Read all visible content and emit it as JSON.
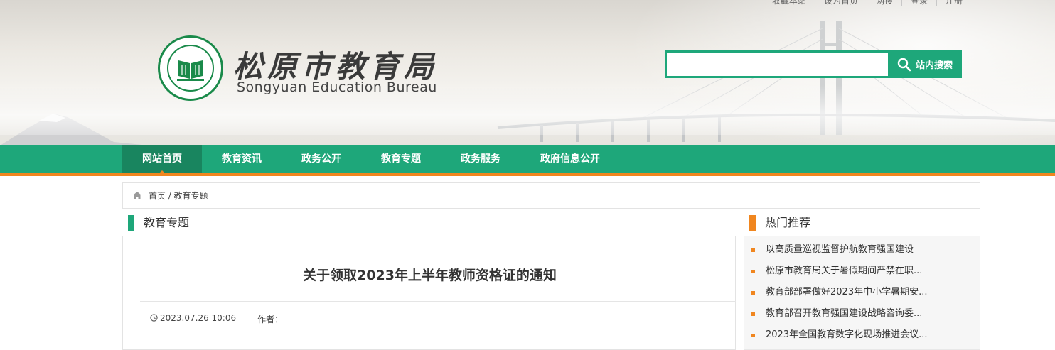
{
  "top_links": [
    "收藏本站",
    "设为首页",
    "网搜",
    "登录",
    "注册"
  ],
  "site": {
    "title": "松原市教育局",
    "subtitle": "Songyuan Education Bureau"
  },
  "search": {
    "placeholder": "",
    "button_label": "站内搜索"
  },
  "nav": {
    "items": [
      "网站首页",
      "教育资讯",
      "政务公开",
      "教育专题",
      "政务服务",
      "政府信息公开"
    ]
  },
  "breadcrumb": {
    "home": "首页",
    "separator": "/",
    "current": "教育专题"
  },
  "main": {
    "section_title": "教育专题",
    "article_title": "关于领取2023年上半年教师资格证的通知",
    "date": "2023.07.26 10:06",
    "author_label": "作者："
  },
  "sidebar": {
    "title": "热门推荐",
    "items": [
      "以高质量巡视监督护航教育强国建设",
      "松原市教育局关于暑假期间严禁在职...",
      "教育部部署做好2023年中小学暑期安...",
      "教育部召开教育强国建设战略咨询委...",
      "2023年全国教育数字化现场推进会议..."
    ]
  },
  "colors": {
    "primary_green": "#1ea77a",
    "accent_orange": "#f0861f"
  }
}
